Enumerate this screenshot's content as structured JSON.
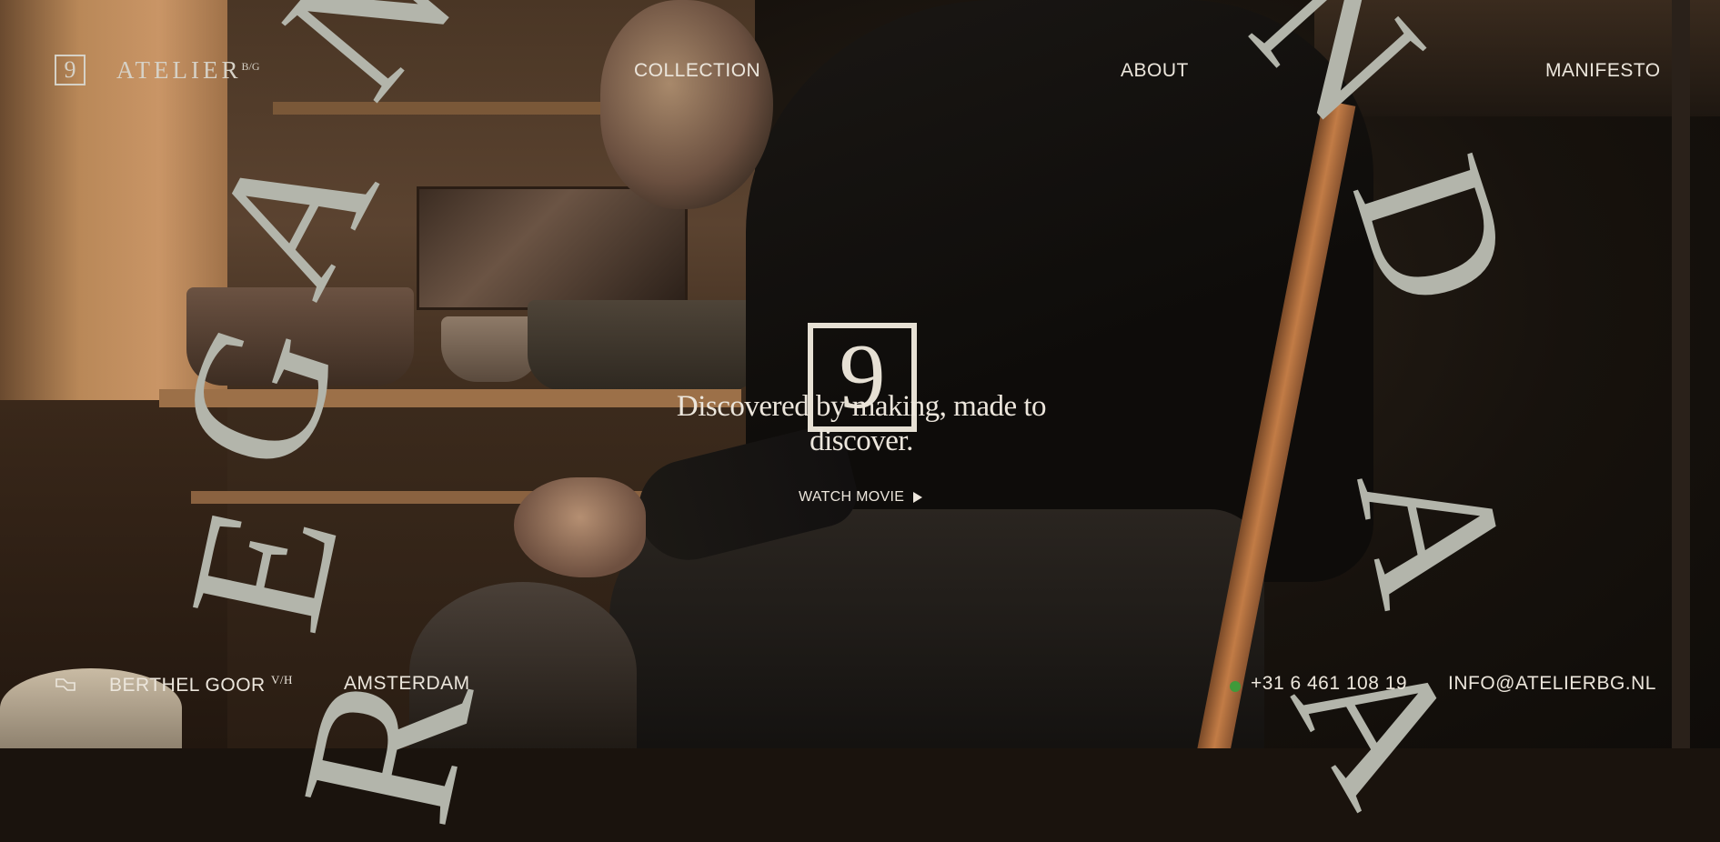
{
  "brand": {
    "name": "ATELIER",
    "suffix": "B/G",
    "mark": "9"
  },
  "nav": {
    "items": [
      {
        "label": "COLLECTION"
      },
      {
        "label": "ABOUT"
      },
      {
        "label": "MANIFESTO"
      }
    ]
  },
  "hero": {
    "mark": "9",
    "headline": "Discovered by making, made to discover.",
    "watch_label": "WATCH MOVIE",
    "big_letters": [
      "R",
      "E",
      "G",
      "A",
      "N",
      "N",
      "D",
      "A",
      "A"
    ]
  },
  "footer": {
    "maker": "BERTHEL GOOR",
    "maker_suffix": "V/H",
    "city": "AMSTERDAM",
    "phone": "+31 6 461 108 19",
    "email": "INFO@ATELIERBG.NL",
    "status_color": "#3f9a3a"
  },
  "icons": {
    "logo": "ring-9-mark-icon",
    "play": "play-icon",
    "flag": "flag-icon",
    "status": "status-dot-icon"
  },
  "colors": {
    "text": "#ece6dc",
    "big_letters": "#b3b5ab",
    "background": "#1a130d"
  }
}
